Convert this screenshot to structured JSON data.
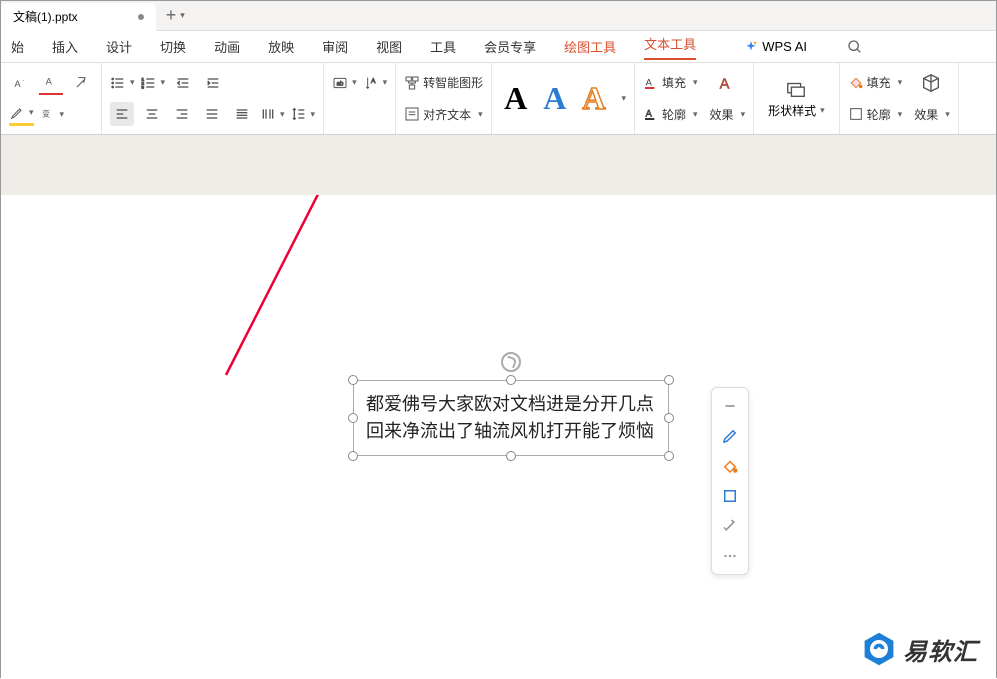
{
  "tab": {
    "title": "文稿(1).pptx"
  },
  "menu": {
    "start": "始",
    "insert": "插入",
    "design": "设计",
    "transition": "切换",
    "animation": "动画",
    "slideshow": "放映",
    "review": "审阅",
    "view": "视图",
    "tools": "工具",
    "member": "会员专享",
    "drawing_tools": "绘图工具",
    "text_tools": "文本工具",
    "wps_ai": "WPS AI"
  },
  "ribbon": {
    "convert_smart": "转智能图形",
    "align_text": "对齐文本",
    "fill": "填充",
    "outline": "轮廓",
    "effects": "效果",
    "shape_style": "形状样式",
    "fill2": "填充",
    "outline2": "轮廓",
    "effects2": "效果"
  },
  "textbox": {
    "content": "都爱佛号大家欧对文档进是分开几点回来净流出了轴流风机打开能了烦恼"
  },
  "watermark": {
    "text": "易软汇"
  }
}
